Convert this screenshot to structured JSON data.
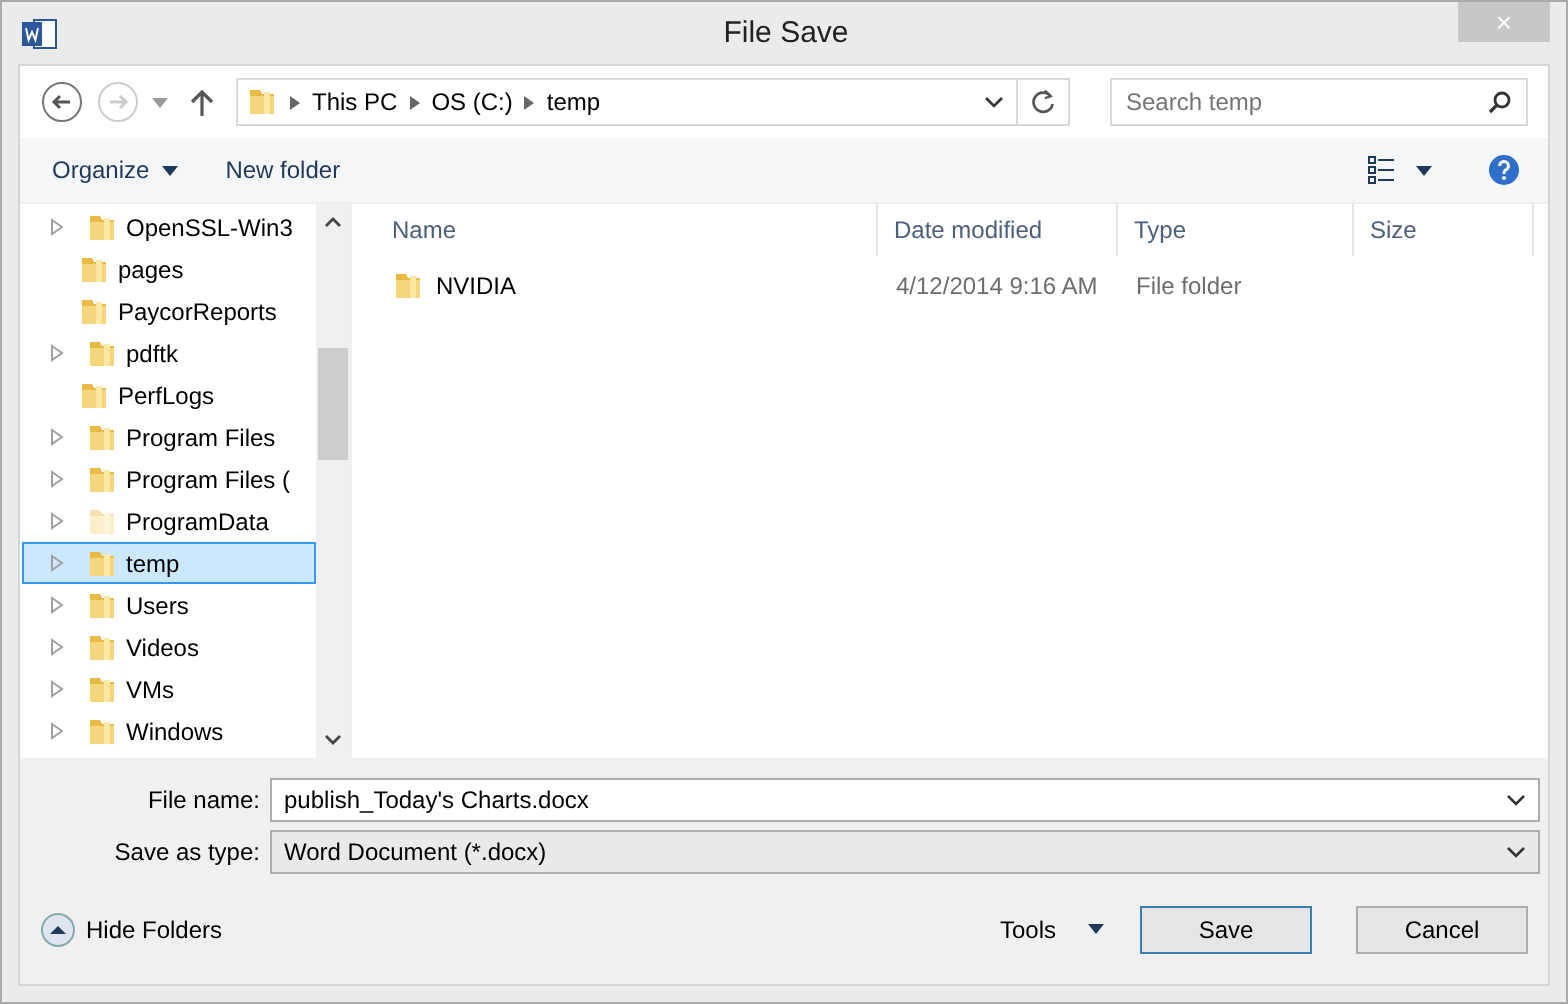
{
  "window": {
    "title": "File Save",
    "close": "×"
  },
  "address": {
    "segments": [
      "This PC",
      "OS (C:)",
      "temp"
    ]
  },
  "search": {
    "placeholder": "Search temp"
  },
  "toolbar": {
    "organize": "Organize",
    "new_folder": "New folder"
  },
  "tree": [
    {
      "name": "OpenSSL-Win3",
      "expandable": true,
      "selected": false,
      "hidden": false
    },
    {
      "name": "pages",
      "expandable": false,
      "selected": false,
      "hidden": false
    },
    {
      "name": "PaycorReports",
      "expandable": false,
      "selected": false,
      "hidden": false
    },
    {
      "name": "pdftk",
      "expandable": true,
      "selected": false,
      "hidden": false
    },
    {
      "name": "PerfLogs",
      "expandable": false,
      "selected": false,
      "hidden": false
    },
    {
      "name": "Program Files",
      "expandable": true,
      "selected": false,
      "hidden": false
    },
    {
      "name": "Program Files (",
      "expandable": true,
      "selected": false,
      "hidden": false
    },
    {
      "name": "ProgramData",
      "expandable": true,
      "selected": false,
      "hidden": true
    },
    {
      "name": "temp",
      "expandable": true,
      "selected": true,
      "hidden": false
    },
    {
      "name": "Users",
      "expandable": true,
      "selected": false,
      "hidden": false
    },
    {
      "name": "Videos",
      "expandable": true,
      "selected": false,
      "hidden": false
    },
    {
      "name": "VMs",
      "expandable": true,
      "selected": false,
      "hidden": false
    },
    {
      "name": "Windows",
      "expandable": true,
      "selected": false,
      "hidden": false
    }
  ],
  "table": {
    "columns": [
      "Name",
      "Date modified",
      "Type",
      "Size"
    ],
    "rows": [
      {
        "name": "NVIDIA",
        "date_modified": "4/12/2014 9:16 AM",
        "type": "File folder"
      }
    ]
  },
  "file_name": {
    "label": "File name:",
    "value": "publish_Today's Charts.docx"
  },
  "save_as_type": {
    "label": "Save as type:",
    "value": "Word Document (*.docx)"
  },
  "hide_folders": "Hide Folders",
  "buttons": {
    "tools": "Tools",
    "save": "Save",
    "cancel": "Cancel"
  }
}
